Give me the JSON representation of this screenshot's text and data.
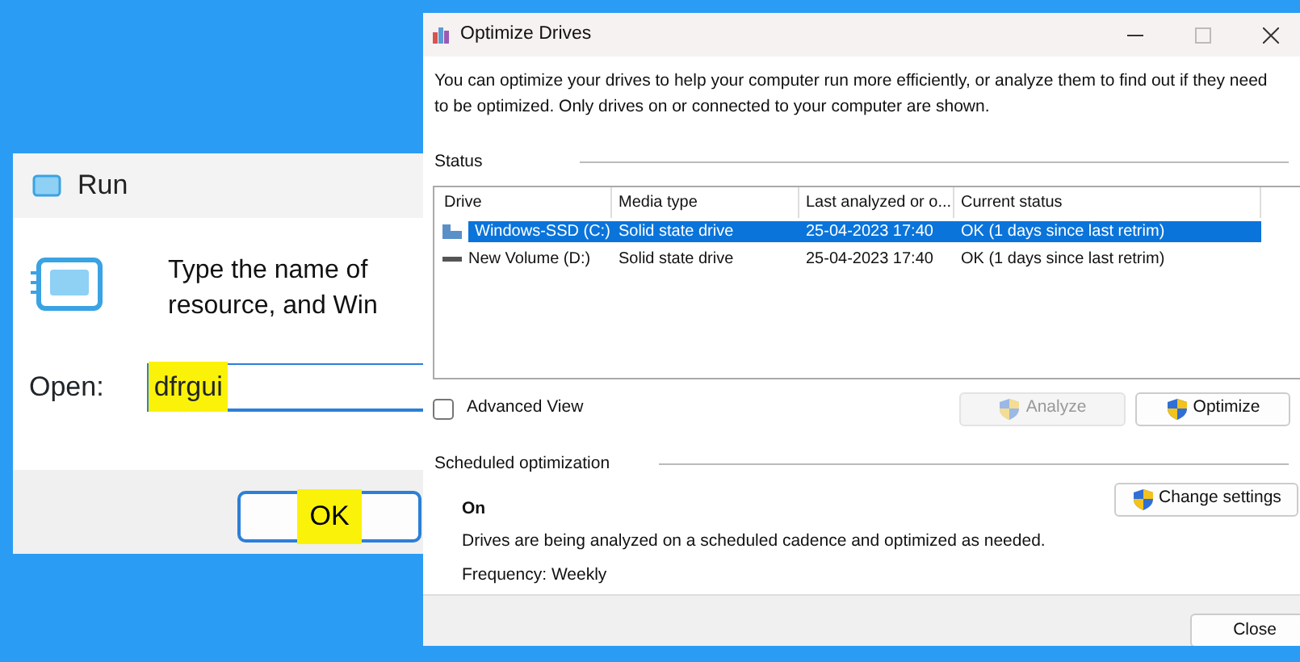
{
  "run_dialog": {
    "title": "Run",
    "prompt_lines": [
      "Type the name of",
      "resource, and Win"
    ],
    "open_label": "Open:",
    "open_value": {
      "text": "dfrgui",
      "highlighted": true
    },
    "ok_button": {
      "label": "OK",
      "highlighted": true
    }
  },
  "optimize_window": {
    "title": "Optimize Drives",
    "description": "You can optimize your drives to help your computer run more efficiently, or analyze them to find out if they need to be optimized. Only drives on or connected to your computer are shown.",
    "status_label": "Status",
    "table": {
      "columns": [
        "Drive",
        "Media type",
        "Last analyzed or o...",
        "Current status"
      ],
      "rows": [
        {
          "kind": "system",
          "drive": "Windows-SSD (C:)",
          "media_type": "Solid state drive",
          "last_analyzed": "25-04-2023 17:40",
          "current_status": "OK (1 days since last retrim)",
          "selected": true
        },
        {
          "kind": "volume",
          "drive": "New Volume (D:)",
          "media_type": "Solid state drive",
          "last_analyzed": "25-04-2023 17:40",
          "current_status": "OK (1 days since last retrim)",
          "selected": false
        }
      ]
    },
    "advanced_view": {
      "label": "Advanced View",
      "checked": false
    },
    "buttons": [
      {
        "label": "Analyze",
        "disabled": true
      },
      {
        "label": "Optimize",
        "disabled": false
      }
    ],
    "schedule": {
      "heading": "Scheduled optimization",
      "state": "On",
      "description": "Drives are being analyzed on a scheduled cadence and optimized as needed.",
      "frequency": "Frequency: Weekly",
      "button": {
        "label": "Change settings",
        "disabled": false
      }
    },
    "close_button": {
      "label": "Close"
    }
  }
}
